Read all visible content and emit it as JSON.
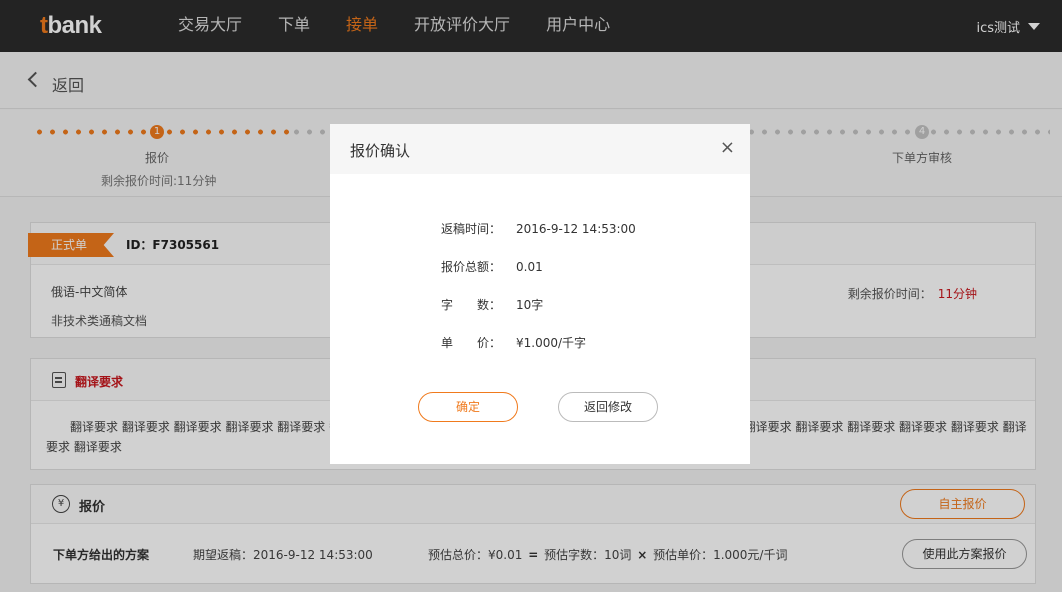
{
  "header": {
    "logo_t": "t",
    "logo_rest": "bank",
    "nav": [
      {
        "label": "交易大厅"
      },
      {
        "label": "下单"
      },
      {
        "label": "接单"
      },
      {
        "label": "开放评价大厅"
      },
      {
        "label": "用户中心"
      }
    ],
    "active_nav": "接单",
    "user": "ics测试"
  },
  "back": {
    "label": "返回"
  },
  "progress": {
    "step1": {
      "num": "1",
      "label": "报价",
      "sub": "剩余报价时间:11分钟"
    },
    "step4": {
      "num": "4",
      "label": "下单方审核"
    }
  },
  "order": {
    "badge": "正式单",
    "id": "ID：F7305561",
    "language_pair": "俄语-中文简体",
    "doc_type": "非技术类通稿文档",
    "remain_label": "剩余报价时间：",
    "remain_value": "11分钟"
  },
  "requirements": {
    "title": "翻译要求",
    "body": "翻译要求 翻译要求 翻译要求 翻译要求 翻译要求 翻译要求 翻译要求 翻译要求 翻译要求 翻译要求 翻译要求 翻译要求 翻译要求 翻译要求 翻译要求 翻译要求 翻译要求 翻译要求 翻译要求 翻译要求"
  },
  "quote": {
    "title": "报价",
    "self_quote": "自主报价",
    "scheme_label": "下单方给出的方案",
    "expect_time": "期望返稿：2016-9-12 14:53:00",
    "est_total": "预估总价：¥0.01",
    "op_eq": "=",
    "est_words": "预估字数：10词",
    "op_mul": "×",
    "est_unit": "预估单价：1.000元/千词",
    "use_scheme": "使用此方案报价"
  },
  "modal": {
    "title": "报价确认",
    "close": "×",
    "rows": [
      {
        "key": "返稿时间：",
        "value": "2016-9-12 14:53:00"
      },
      {
        "key": "报价总额：",
        "value": "0.01"
      },
      {
        "key": "字　　数：",
        "value": "10字"
      },
      {
        "key": "单　　价：",
        "value": "¥1.000/千字"
      }
    ],
    "confirm": "确定",
    "back_edit": "返回修改"
  },
  "colors": {
    "accent": "#f07a1d",
    "nav_bg": "#2b2b2b",
    "alert": "#c8161d"
  }
}
